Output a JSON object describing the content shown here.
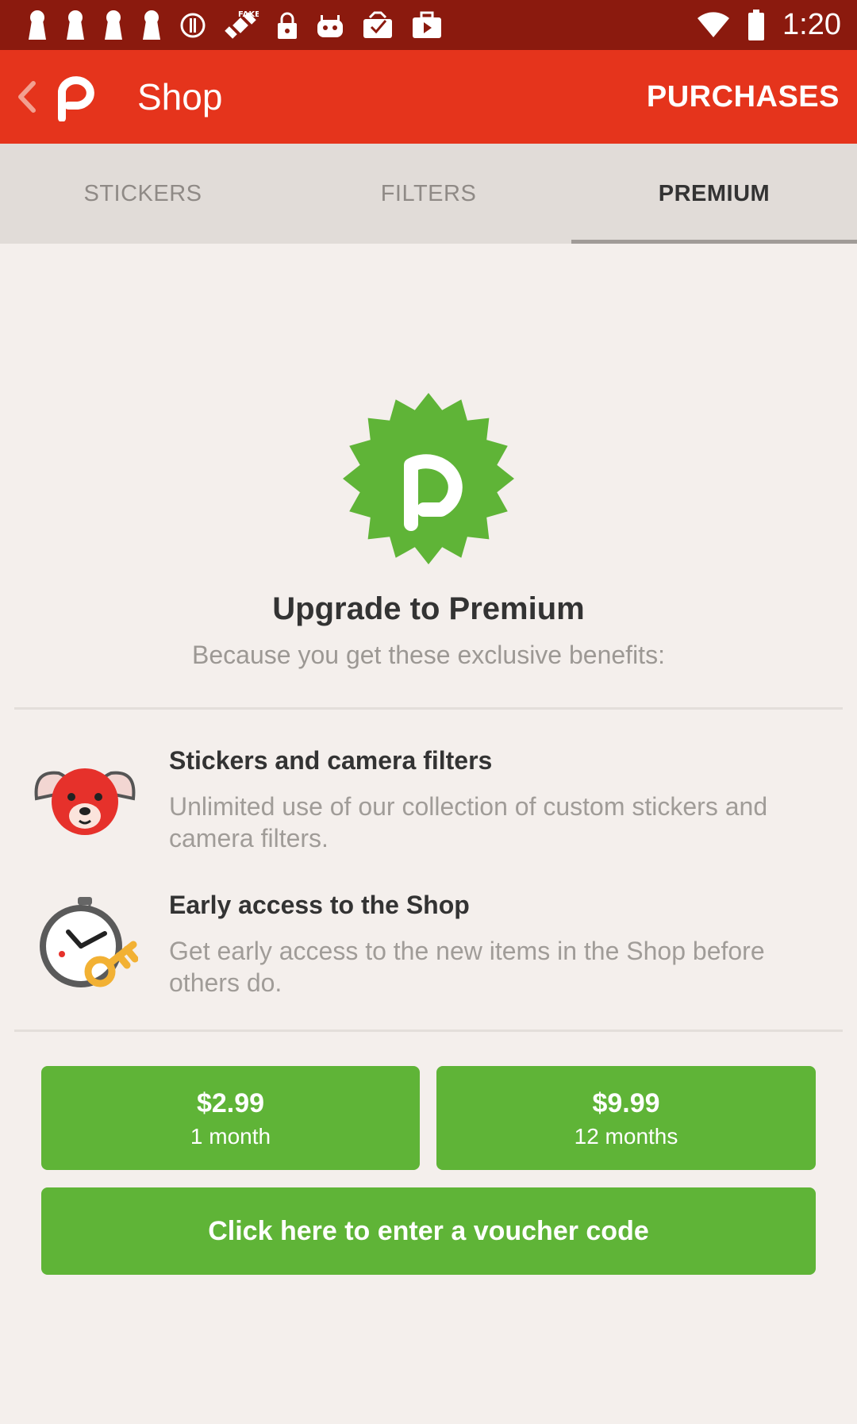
{
  "status_bar": {
    "time": "1:20",
    "icons": [
      "keyhole-icon",
      "keyhole-icon",
      "keyhole-icon",
      "keyhole-icon",
      "alert-icon",
      "satellite-icon",
      "lock-icon",
      "android-icon",
      "inbox-icon",
      "briefcase-icon",
      "wifi-icon",
      "battery-icon"
    ]
  },
  "app_bar": {
    "title": "Shop",
    "action": "PURCHASES"
  },
  "tabs": [
    {
      "label": "STICKERS",
      "active": false
    },
    {
      "label": "FILTERS",
      "active": false
    },
    {
      "label": "PREMIUM",
      "active": true
    }
  ],
  "premium": {
    "headline": "Upgrade to Premium",
    "subline": "Because you get these exclusive benefits:",
    "benefits": [
      {
        "icon": "bear-sticker-icon",
        "title": "Stickers and camera filters",
        "description": "Unlimited use of our collection of custom stickers and camera filters."
      },
      {
        "icon": "stopwatch-key-icon",
        "title": "Early access to the Shop",
        "description": "Get early access to the new items in the Shop before others do."
      }
    ],
    "plans": [
      {
        "price": "$2.99",
        "period": "1 month"
      },
      {
        "price": "$9.99",
        "period": "12 months"
      }
    ],
    "voucher_label": "Click here to enter a voucher code"
  },
  "colors": {
    "status_bar": "#8b1a0e",
    "app_bar": "#e5341c",
    "tab_bar": "#e1dcd8",
    "background": "#f4efec",
    "accent_green": "#5fb437"
  }
}
